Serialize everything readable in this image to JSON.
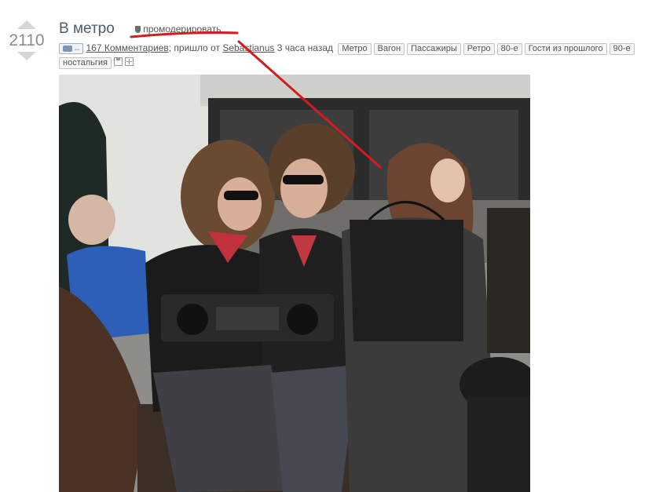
{
  "post": {
    "rating": "2110",
    "title": "В метро",
    "moderate_label": "промодерировать",
    "media_badge": "–",
    "comments_link": "167 Комментариев",
    "posted_by_prefix": "; пришло от",
    "author": "Sebastianus",
    "time_ago": "3 часа назад",
    "tags": [
      "Метро",
      "Вагон",
      "Пассажиры",
      "Ретро",
      "80-е",
      "Гости из прошлого",
      "90-е",
      "ностальгия"
    ]
  },
  "colors": {
    "annotation": "#d41c1c",
    "title": "#4d5e6a",
    "rating": "#8c8c8c"
  },
  "icons": {
    "vote_up": "arrow-up-icon",
    "vote_down": "arrow-down-icon",
    "moderate": "shield-icon",
    "media": "camera-icon",
    "save": "save-icon",
    "add": "plus-icon"
  }
}
